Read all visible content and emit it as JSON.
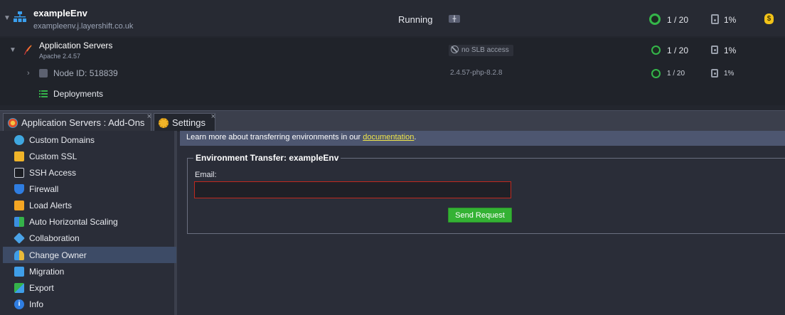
{
  "environment": {
    "name": "exampleEnv",
    "domain": "exampleenv.j.layershift.co.uk",
    "status": "Running",
    "region_flag": "uk-flag",
    "cloudlets": "1 / 20",
    "disk": "1%"
  },
  "app_servers": {
    "title": "Application Servers",
    "version": "Apache 2.4.57",
    "slb": "no SLB access",
    "cloudlets": "1 / 20",
    "disk": "1%"
  },
  "node": {
    "label": "Node ID: 518839",
    "version": "2.4.57-php-8.2.8",
    "cloudlets": "1 / 20",
    "disk": "1%"
  },
  "deployments": {
    "label": "Deployments"
  },
  "tabs": [
    {
      "label": "Application Servers : Add-Ons",
      "close": "×"
    },
    {
      "label": "Settings",
      "close": "×"
    }
  ],
  "sidebar": {
    "items": [
      {
        "label": "Custom Domains",
        "color": "#3fa7e0"
      },
      {
        "label": "Custom SSL",
        "color": "#f0b429"
      },
      {
        "label": "SSH Access",
        "color": "#c8ccd6"
      },
      {
        "label": "Firewall",
        "color": "#2f7de1"
      },
      {
        "label": "Load Alerts",
        "color": "#f5a623"
      },
      {
        "label": "Auto Horizontal Scaling",
        "color": "#3b8fe0"
      },
      {
        "label": "Collaboration",
        "color": "#4aa3e8"
      },
      {
        "label": "Change Owner",
        "color": "#e8b93a"
      },
      {
        "label": "Migration",
        "color": "#3f9ee8"
      },
      {
        "label": "Export",
        "color": "#35b24a"
      },
      {
        "label": "Info",
        "color": "#2f7de1"
      }
    ],
    "active": "Change Owner"
  },
  "settings": {
    "info_text": "Learn more about transferring environments in our ",
    "info_link": "documentation",
    "info_tail": ".",
    "fieldset_title": "Environment Transfer: exampleEnv",
    "email_label": "Email:",
    "email_value": "",
    "send_button": "Send Request"
  },
  "colors": {
    "accent_green": "#34b234",
    "link_yellow": "#f0e64a",
    "error_border": "#c0291f"
  }
}
